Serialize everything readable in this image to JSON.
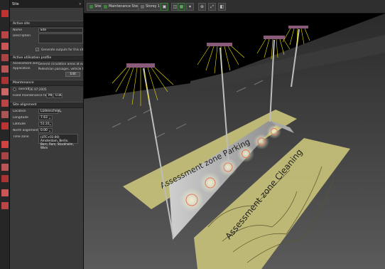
{
  "panel": {
    "title": "Site",
    "sections": {
      "active_site": "Active site",
      "activation_profile": "Active utilisation profile",
      "maintenance": "Maintenance",
      "site_alignment": "Site alignment"
    },
    "fields": {
      "name_label": "Name",
      "name_value": "Site",
      "description_label": "Description",
      "generate_outputs_label": "Generate outputs for this site",
      "generate_outputs_checked": "✓",
      "assessment_zone_label": "Assessment zone",
      "assessment_zone_value": "General circulation areas at outdoor w...",
      "application_label": "Application",
      "application_value": "Pedestrian passages, vehicle turning, l...",
      "edit_button": "Edit",
      "overall_label": "overall",
      "overall_value": "CIE 97:2005",
      "fixed_mf_label": "Fixed maintenance factor",
      "fixed_mf_unit": "MF",
      "fixed_mf_value": "0.80",
      "location_label": "Location",
      "location_value": "Lüdenscheid",
      "longitude_label": "Longitude",
      "longitude_value": "7.63",
      "latitude_label": "Latitude",
      "latitude_value": "51.22",
      "north_alignment_label": "North alignment",
      "north_alignment_value": "0.00",
      "time_zone_label": "Time zone",
      "time_zone_value": "(UTC+01:00) Amsterdam, Berlin, Bern, Rom, Stockholm, Wien"
    }
  },
  "toolbar": {
    "tab_site": "Site",
    "tab_maintenance": "Maintenance Stock",
    "tab_storey": "Storey 1"
  },
  "scene": {
    "zone_label_1": "Assessment zone Parking",
    "zone_label_2": "Assessment zone Cleaning"
  },
  "colors": {
    "panel_bg": "#3a3a3a",
    "zone_yellow": "#c8c27a",
    "beam_yellow": "#f2e200",
    "active_tab_green": "#3f7d3f"
  }
}
